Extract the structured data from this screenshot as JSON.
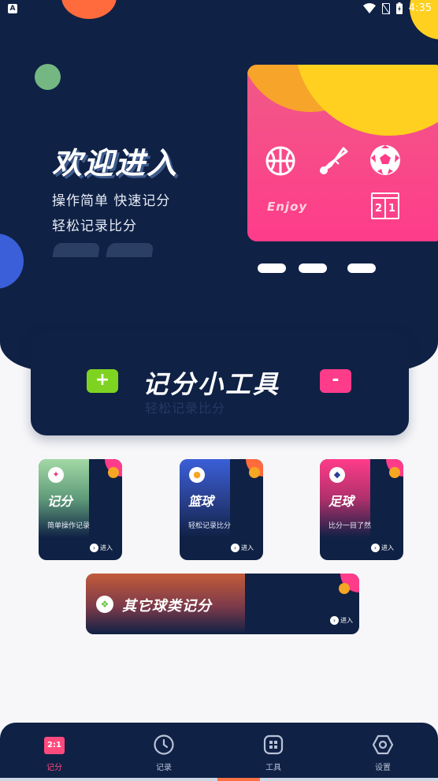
{
  "status_bar": {
    "left_badge": "A",
    "time": "4:35",
    "icons": [
      "wifi-icon",
      "no-sim-icon",
      "battery-charging-icon"
    ]
  },
  "hero": {
    "title": "欢迎进入",
    "sub_line_1": "操作简单  快速记分",
    "sub_line_2": "轻松记录比分",
    "card_text": "Enjoy",
    "card_icons": [
      "basketball-icon",
      "shuttlecock-icon",
      "soccer-ball-icon",
      "scoreboard-icon"
    ],
    "scoreboard_left": "2",
    "scoreboard_right": "1"
  },
  "tool_panel": {
    "plus_label": "+",
    "title": "记分小工具",
    "subtitle": "轻松记录比分",
    "minus_label": "-"
  },
  "modules": [
    {
      "name": "记分",
      "desc": "简单操作记录",
      "enter": "进入",
      "icon": "badminton-icon",
      "accent": "#a3d9a5"
    },
    {
      "name": "篮球",
      "desc": "轻松记录比分",
      "enter": "进入",
      "icon": "basketball-icon",
      "accent": "#3a5fd8"
    },
    {
      "name": "足球",
      "desc": "比分一目了然",
      "enter": "进入",
      "icon": "soccer-ball-icon",
      "accent": "#ff3c8a"
    }
  ],
  "wide_module": {
    "name": "其它球类记分",
    "enter": "进入",
    "icon": "grid-icon"
  },
  "tabs": [
    {
      "label": "记分",
      "icon": "scoreboard-icon",
      "active": true
    },
    {
      "label": "记录",
      "icon": "clock-icon",
      "active": false
    },
    {
      "label": "工具",
      "icon": "apps-icon",
      "active": false
    },
    {
      "label": "设置",
      "icon": "hex-settings-icon",
      "active": false
    }
  ],
  "colors": {
    "navy": "#0f2145",
    "pink": "#ff3c8a",
    "orange": "#f5a623",
    "green": "#7ed321",
    "active_tab": "#ff4a7e"
  }
}
